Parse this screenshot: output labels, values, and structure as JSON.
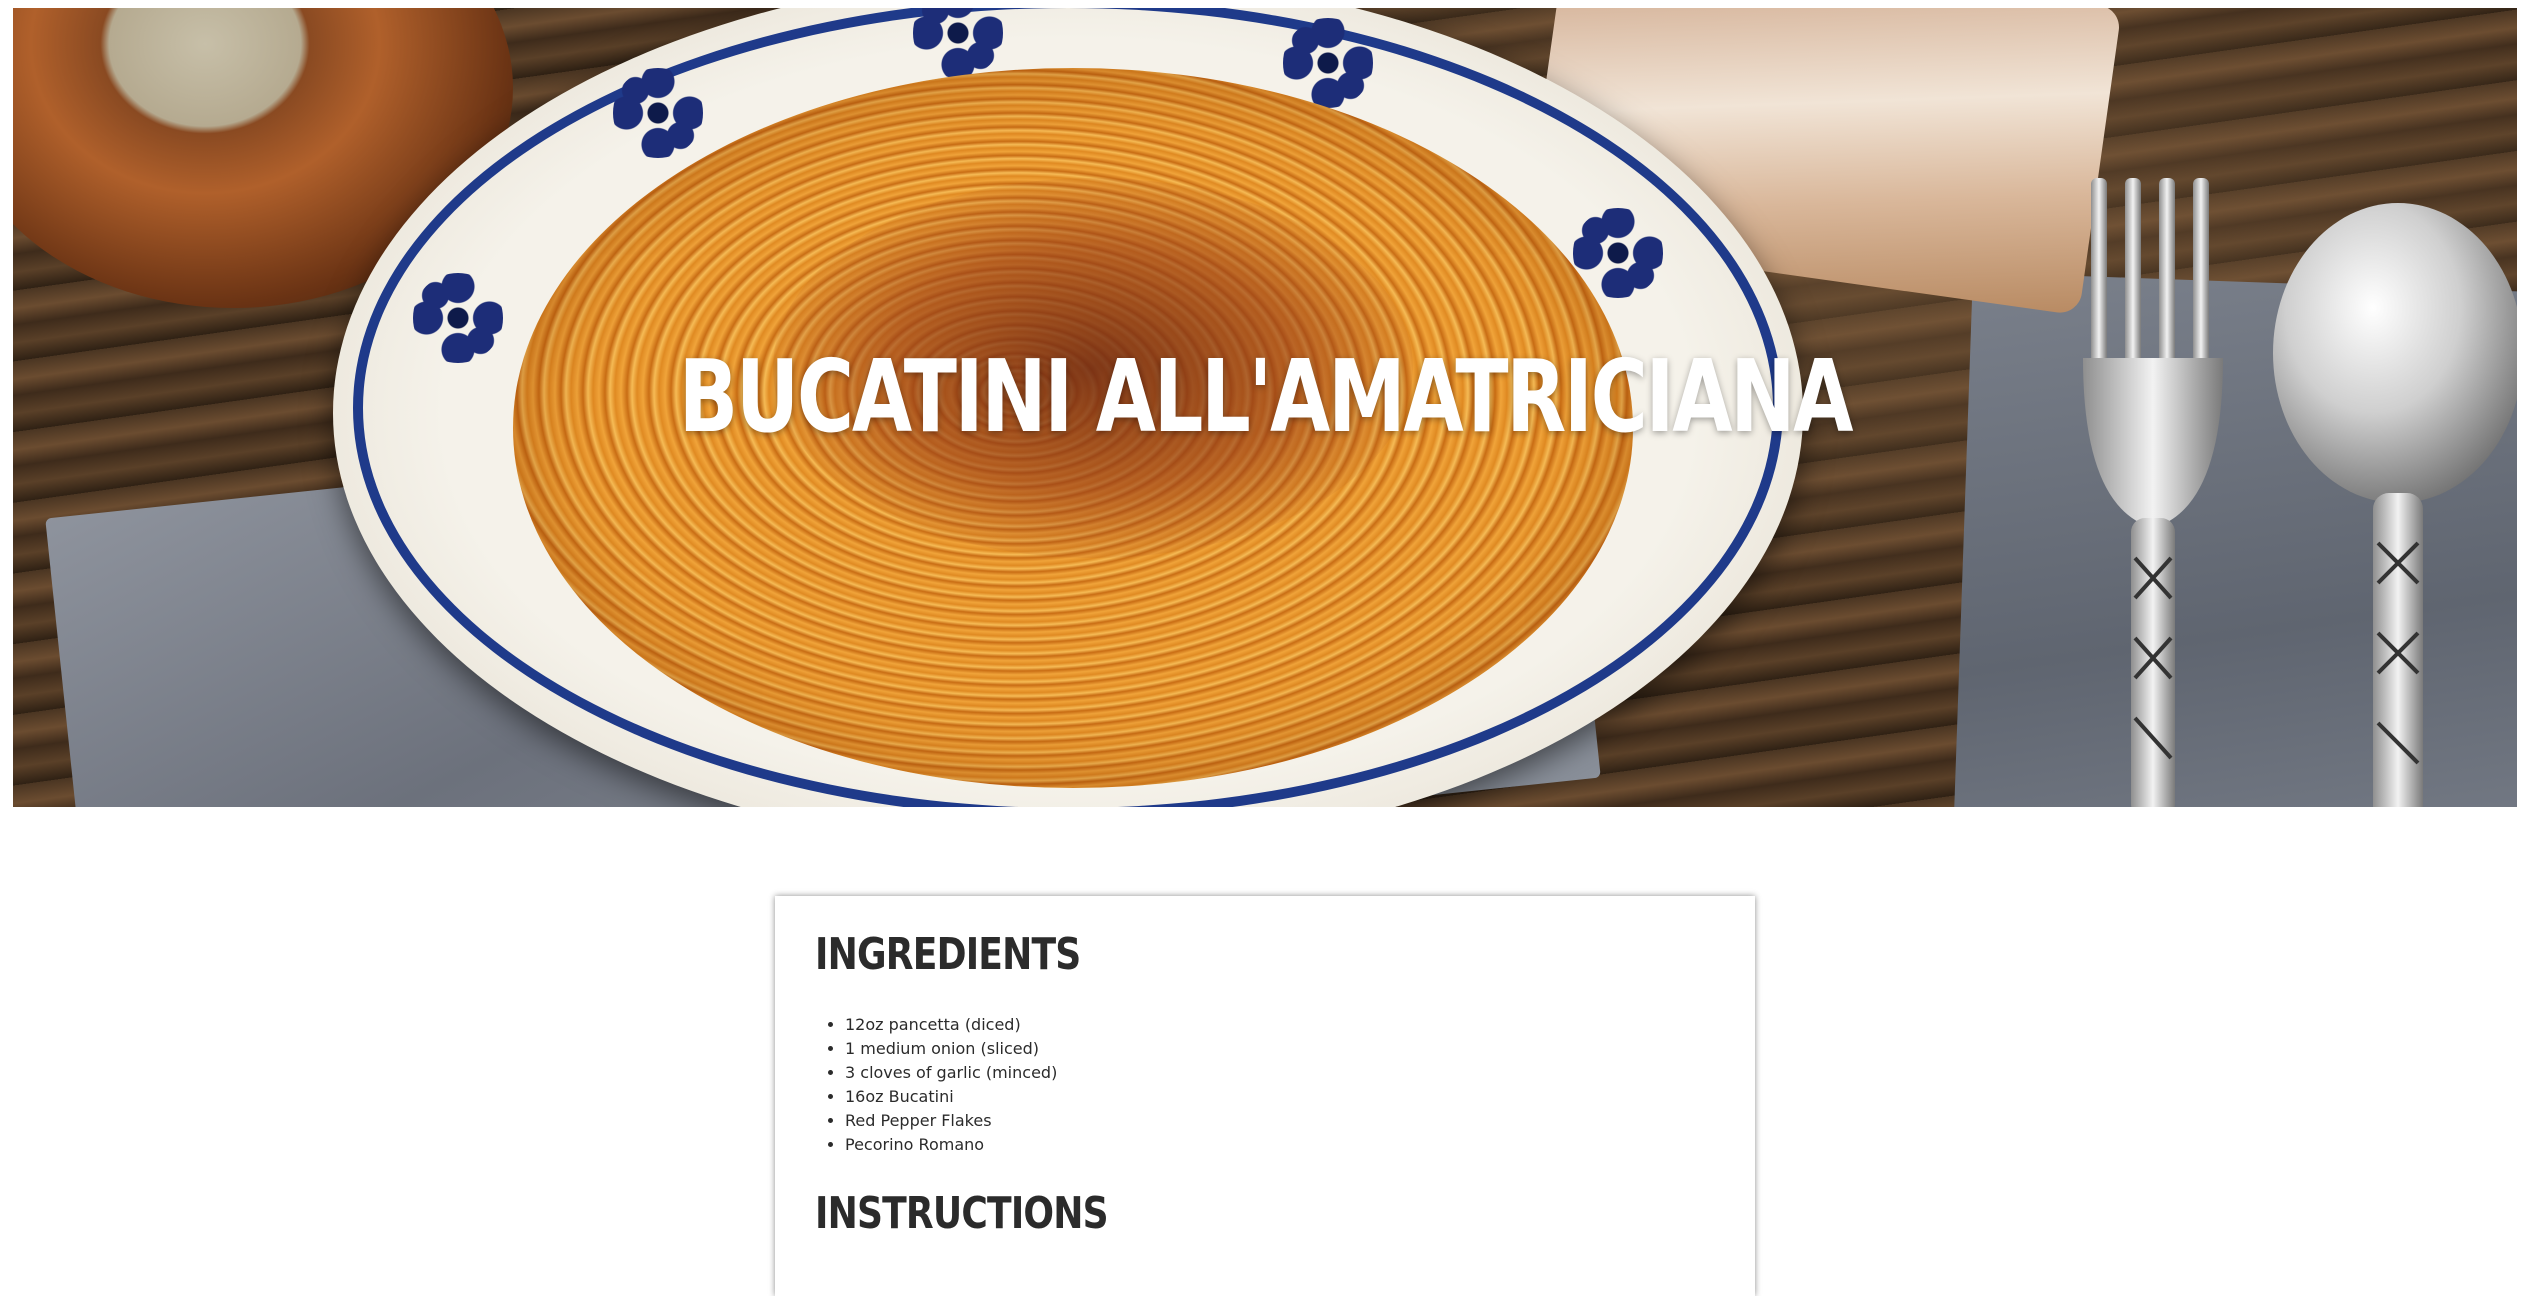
{
  "hero": {
    "title": "Bucatini All'Amatriciana"
  },
  "ingredients": {
    "heading": "Ingredients",
    "items": [
      "12oz pancetta (diced)",
      "1 medium onion (sliced)",
      "3 cloves of garlic (minced)",
      "16oz Bucatini",
      "Red Pepper Flakes",
      "Pecorino Romano"
    ]
  },
  "instructions": {
    "heading": "Instructions"
  },
  "colors": {
    "heading_text": "#2b2b2b",
    "hero_title": "#ffffff",
    "plate_blue": "#1f3a8a"
  }
}
